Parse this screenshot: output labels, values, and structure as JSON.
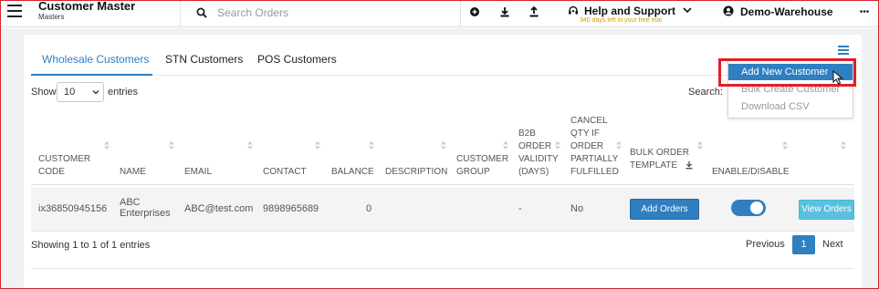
{
  "app": {
    "title": "Customer Master",
    "subtitle": "Masters"
  },
  "search": {
    "placeholder": "Search Orders",
    "icon": "search-icon"
  },
  "toolbar": {
    "icons": [
      "add-circle-icon",
      "download-icon",
      "upload-icon"
    ]
  },
  "help": {
    "label": "Help and Support",
    "trial_note": "340 days left in your free trial",
    "trial_color": "#d99a00"
  },
  "user": {
    "name": "Demo-Warehouse"
  },
  "tabs": [
    {
      "label": "Wholesale Customers",
      "active": true
    },
    {
      "label": "STN Customers",
      "active": false
    },
    {
      "label": "POS Customers",
      "active": false
    }
  ],
  "menu": {
    "items": [
      {
        "label": "Add New Customer",
        "highlighted": true
      },
      {
        "label": "Bulk Create Customer",
        "highlighted": false
      },
      {
        "label": "Download CSV",
        "highlighted": false
      }
    ]
  },
  "table_controls": {
    "show_label": "Show",
    "page_size": "10",
    "entries_label": "entries",
    "search_label": "Search:"
  },
  "table": {
    "headers": {
      "customer_code": [
        "CUSTOMER",
        "CODE"
      ],
      "name": [
        "NAME"
      ],
      "email": [
        "EMAIL"
      ],
      "contact": [
        "CONTACT"
      ],
      "balance": [
        "BALANCE"
      ],
      "description": [
        "DESCRIPTION"
      ],
      "customer_group": [
        "CUSTOMER",
        "GROUP"
      ],
      "b2b_validity": [
        "B2B",
        "ORDER",
        "VALIDITY",
        "(DAYS)"
      ],
      "cancel_qty": [
        "CANCEL",
        "QTY IF",
        "ORDER",
        "PARTIALLY",
        "FULFILLED"
      ],
      "bulk_order": [
        "BULK ORDER",
        "TEMPLATE"
      ],
      "enable_disable": [
        "ENABLE/DISABLE"
      ]
    },
    "rows": [
      {
        "customer_code": "ix36850945156",
        "name": [
          "ABC",
          "Enterprises"
        ],
        "email": "ABC@test.com",
        "contact": "9898965689",
        "balance": "0",
        "description": "",
        "customer_group": "",
        "b2b_validity": "-",
        "cancel_qty": "No",
        "bulk_order_button": "Add Orders",
        "enabled": true,
        "view_button": "View Orders"
      }
    ]
  },
  "footer": {
    "showing": "Showing 1 to 1 of 1 entries",
    "prev": "Previous",
    "page": "1",
    "next": "Next"
  },
  "colors": {
    "accent": "#2f7fc1",
    "highlight_border": "#e51d26",
    "view_button": "#5bc0de"
  }
}
